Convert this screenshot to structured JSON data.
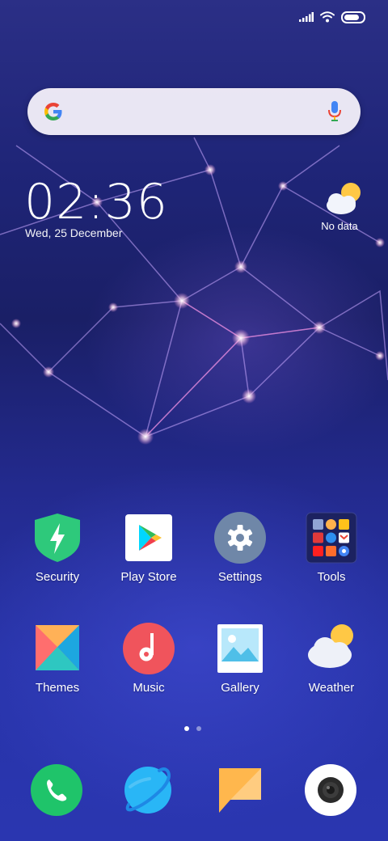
{
  "status_bar": {
    "icons": [
      "signal-icon",
      "wifi-icon",
      "battery-icon"
    ],
    "battery_level": 1.0
  },
  "search": {
    "icons": [
      "google-logo-icon",
      "microphone-icon"
    ]
  },
  "clock_widget": {
    "hour": "02",
    "minute": "36",
    "date": "Wed, 25 December"
  },
  "weather_widget": {
    "icon": "partly-cloudy-icon",
    "text": "No data"
  },
  "apps_row1": [
    {
      "label": "Security",
      "icon": "shield-bolt-icon"
    },
    {
      "label": "Play Store",
      "icon": "play-store-icon"
    },
    {
      "label": "Settings",
      "icon": "gear-icon"
    },
    {
      "label": "Tools",
      "icon": "folder-icon"
    }
  ],
  "apps_row2": [
    {
      "label": "Themes",
      "icon": "themes-icon"
    },
    {
      "label": "Music",
      "icon": "music-note-icon"
    },
    {
      "label": "Gallery",
      "icon": "gallery-icon"
    },
    {
      "label": "Weather",
      "icon": "weather-icon"
    }
  ],
  "page_indicator": {
    "pages": 2,
    "current": 1
  },
  "dock": [
    {
      "name": "phone",
      "icon": "phone-icon",
      "color": "#1fc46a"
    },
    {
      "name": "browser",
      "icon": "planet-icon",
      "color": "#29b6f6"
    },
    {
      "name": "messaging",
      "icon": "message-icon",
      "color": "#ffb74d"
    },
    {
      "name": "camera",
      "icon": "camera-icon",
      "color": "#ffffff"
    }
  ],
  "colors": {
    "search_bg": "#f4f0fa",
    "security": "#2ec97b",
    "settings": "#6f87a8",
    "music": "#f0545c"
  }
}
